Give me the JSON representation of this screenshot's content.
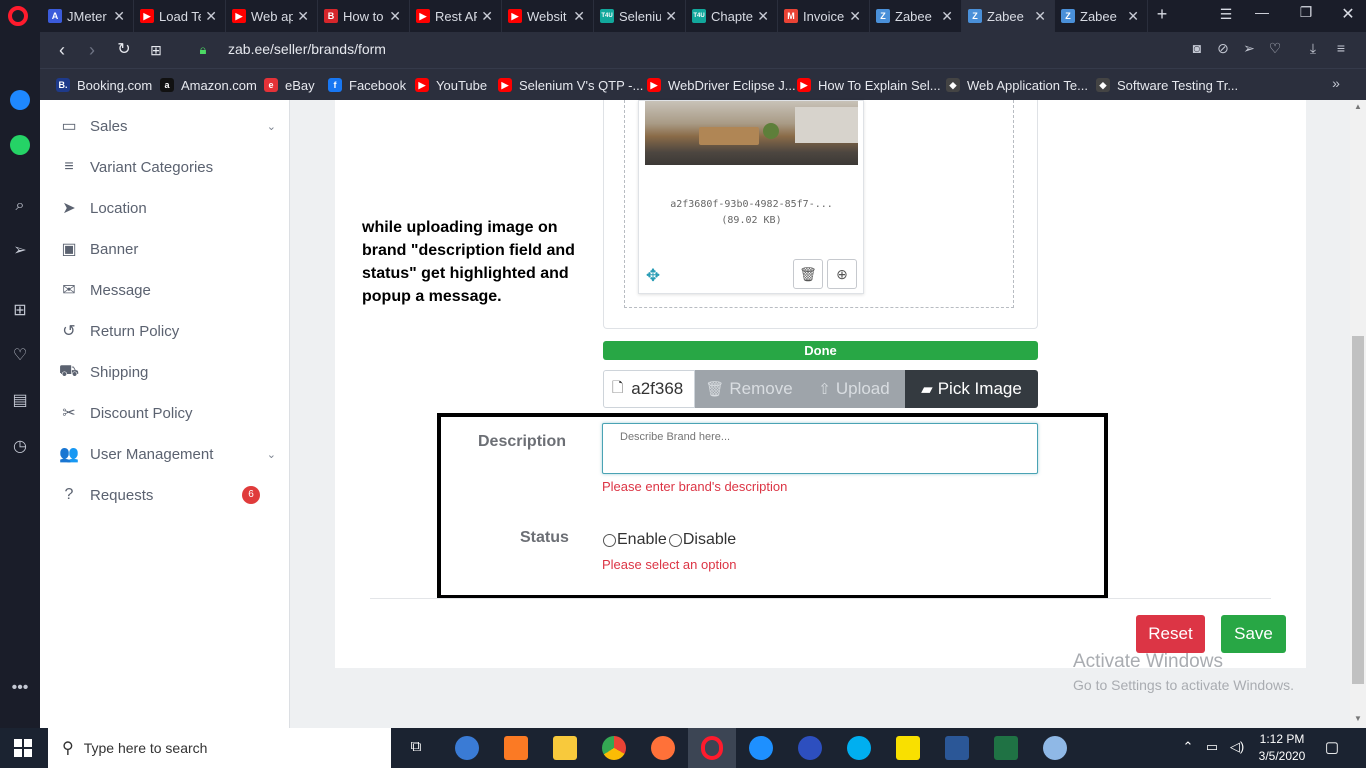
{
  "browser": {
    "tabs": [
      {
        "label": "JMeter",
        "color": "#3b5bdb",
        "glyph": "A"
      },
      {
        "label": "Load Te",
        "color": "#ff0000",
        "glyph": "▶"
      },
      {
        "label": "Web ap",
        "color": "#ff0000",
        "glyph": "▶"
      },
      {
        "label": "How to",
        "color": "#d6262b",
        "glyph": "B"
      },
      {
        "label": "Rest AP",
        "color": "#ff0000",
        "glyph": "▶"
      },
      {
        "label": "Websit",
        "color": "#ff0000",
        "glyph": "▶"
      },
      {
        "label": "Seleniu",
        "color": "#12a89c",
        "glyph": "T4U"
      },
      {
        "label": "Chapte",
        "color": "#12a89c",
        "glyph": "T4U"
      },
      {
        "label": "Invoice",
        "color": "#ea4335",
        "glyph": "M"
      },
      {
        "label": "Zabee",
        "color": "#4a90d9",
        "glyph": "Z"
      },
      {
        "label": "Zabee",
        "color": "#4a90d9",
        "glyph": "Z"
      },
      {
        "label": "Zabee",
        "color": "#4a90d9",
        "glyph": "Z"
      }
    ],
    "url": "zab.ee/seller/brands/form",
    "bookmarks": [
      {
        "label": "Booking.com",
        "color": "#1e3a8a",
        "glyph": "B."
      },
      {
        "label": "Amazon.com",
        "color": "#111111",
        "glyph": "a"
      },
      {
        "label": "eBay",
        "color": "#e53238",
        "glyph": "e"
      },
      {
        "label": "Facebook",
        "color": "#1877f2",
        "glyph": "f"
      },
      {
        "label": "YouTube",
        "color": "#ff0000",
        "glyph": "▶"
      },
      {
        "label": "Selenium V's QTP -...",
        "color": "#ff0000",
        "glyph": "▶"
      },
      {
        "label": "WebDriver Eclipse J...",
        "color": "#ff0000",
        "glyph": "▶"
      },
      {
        "label": "How To Explain Sel...",
        "color": "#ff0000",
        "glyph": "▶"
      },
      {
        "label": "Web Application Te...",
        "color": "#444444",
        "glyph": "◆"
      },
      {
        "label": "Software Testing Tr...",
        "color": "#444444",
        "glyph": "◆"
      }
    ]
  },
  "sidebar": {
    "items": [
      {
        "label": "Sales",
        "icon": "money-icon",
        "glyph": "▭"
      },
      {
        "label": "Variant Categories",
        "icon": "list-icon",
        "glyph": "≡"
      },
      {
        "label": "Location",
        "icon": "location-arrow-icon",
        "glyph": "➤"
      },
      {
        "label": "Banner",
        "icon": "image-icon",
        "glyph": "▣"
      },
      {
        "label": "Message",
        "icon": "envelope-icon",
        "glyph": "✉"
      },
      {
        "label": "Return Policy",
        "icon": "undo-icon",
        "glyph": "↺"
      },
      {
        "label": "Shipping",
        "icon": "truck-icon",
        "glyph": "⛟"
      },
      {
        "label": "Discount Policy",
        "icon": "scissors-icon",
        "glyph": "✂"
      },
      {
        "label": "User Management",
        "icon": "users-icon",
        "glyph": "👥"
      },
      {
        "label": "Requests",
        "icon": "question-circle-icon",
        "glyph": "?"
      }
    ],
    "requests_badge": "6"
  },
  "annotation": {
    "text": "while uploading image on brand \"description field and status\" get highlighted and popup a message."
  },
  "upload": {
    "file_name": "a2f3680f-93b0-4982-85f7-...",
    "file_size": "(89.02 KB)",
    "progress_label": "Done",
    "progress_fraction": 1.0,
    "caption_value": "a2f368",
    "remove_label": "Remove",
    "upload_label": "Upload",
    "pick_label": "Pick Image"
  },
  "form": {
    "description_label": "Description",
    "description_placeholder": "Describe Brand here...",
    "description_error": "Please enter brand's description",
    "status_label": "Status",
    "enable_label": "Enable",
    "disable_label": "Disable",
    "status_error": "Please select an option",
    "reset_label": "Reset",
    "save_label": "Save"
  },
  "watermark": {
    "title": "Activate Windows",
    "subtitle": "Go to Settings to activate Windows."
  },
  "taskbar": {
    "search_placeholder": "Type here to search",
    "time": "1:12 PM",
    "date": "3/5/2020"
  },
  "colors": {
    "accent_green": "#28a745",
    "danger": "#dc3545",
    "dark": "#343a40",
    "error_text": "#dc3545"
  }
}
